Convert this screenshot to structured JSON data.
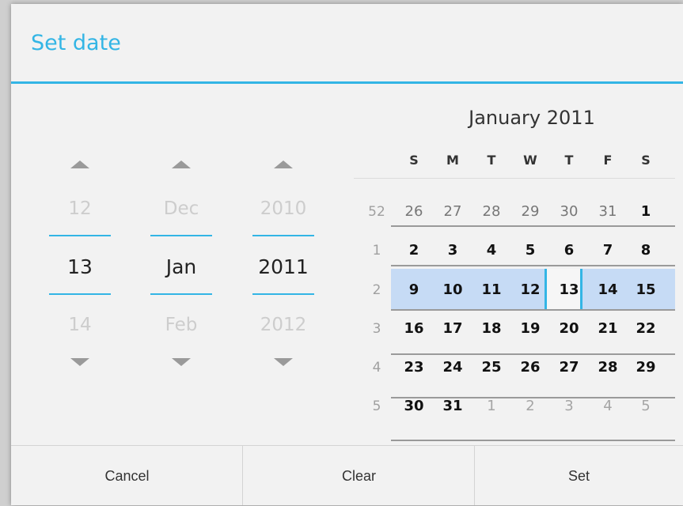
{
  "dialog": {
    "title": "Set date"
  },
  "spinners": [
    {
      "name": "day",
      "prev": "12",
      "current": "13",
      "next": "14"
    },
    {
      "name": "month",
      "prev": "Dec",
      "current": "Jan",
      "next": "Feb"
    },
    {
      "name": "year",
      "prev": "2010",
      "current": "2011",
      "next": "2012"
    }
  ],
  "calendar": {
    "month_title": "January 2011",
    "weekdays": [
      "S",
      "M",
      "T",
      "W",
      "T",
      "F",
      "S"
    ],
    "weeks": [
      {
        "num": "52",
        "days": [
          "26",
          "27",
          "28",
          "29",
          "30",
          "31",
          "1"
        ]
      },
      {
        "num": "1",
        "days": [
          "2",
          "3",
          "4",
          "5",
          "6",
          "7",
          "8"
        ]
      },
      {
        "num": "2",
        "days": [
          "9",
          "10",
          "11",
          "12",
          "13",
          "14",
          "15"
        ]
      },
      {
        "num": "3",
        "days": [
          "16",
          "17",
          "18",
          "19",
          "20",
          "21",
          "22"
        ]
      },
      {
        "num": "4",
        "days": [
          "23",
          "24",
          "25",
          "26",
          "27",
          "28",
          "29"
        ]
      },
      {
        "num": "5",
        "days": [
          "30",
          "31",
          "1",
          "2",
          "3",
          "4",
          "5"
        ]
      }
    ],
    "selected_day": "13"
  },
  "buttons": {
    "cancel": "Cancel",
    "clear": "Clear",
    "set": "Set"
  },
  "colors": {
    "accent": "#33b5e5",
    "selected_week": "#c6dbf5"
  }
}
